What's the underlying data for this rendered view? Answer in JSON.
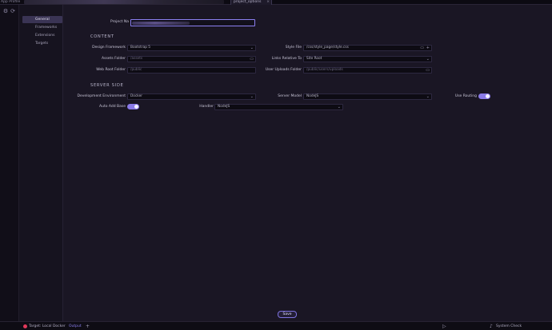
{
  "app": {
    "title": "App Profile",
    "active_tab": "project_options",
    "active_tab_close": "×"
  },
  "activity": {
    "settings_icon": "⚙",
    "sync_icon": "⟳"
  },
  "nav": {
    "items": [
      "General",
      "Frameworks",
      "Extensions",
      "Targets"
    ]
  },
  "form": {
    "project_name_label": "Project Na",
    "content_heading": "CONTENT",
    "design_framework_label": "Design Framework",
    "design_framework_value": "Bootstrap 5",
    "assets_folder_label": "Assets Folder",
    "assets_folder_placeholder": "/assets",
    "web_root_label": "Web Root Folder",
    "web_root_placeholder": "/public",
    "style_file_label": "Style File",
    "style_file_value": "/css/style_page/style.css",
    "links_relative_label": "Links Relative To",
    "links_relative_value": "Site Root",
    "user_uploads_label": "User Uploads Folder",
    "user_uploads_placeholder": "/public/users/uploads",
    "server_heading": "SERVER SIDE",
    "dev_env_label": "Development Environment",
    "dev_env_value": "Docker",
    "server_model_label": "Server Model",
    "server_model_value": "NodeJS",
    "use_routing_label": "Use Routing",
    "auto_add_base_label": "Auto Add Base",
    "handler_label": "Handler",
    "handler_value": "NodeJS",
    "save_label": "Save",
    "chevron": "⌄",
    "folder_icon": "▭",
    "plus_icon": "+"
  },
  "status": {
    "target_label": "Target: Local Docker",
    "output_label": "Output",
    "add_icon": "+",
    "system_check_label": "System Check",
    "play_icon": "▷",
    "bell_icon": "♪"
  }
}
